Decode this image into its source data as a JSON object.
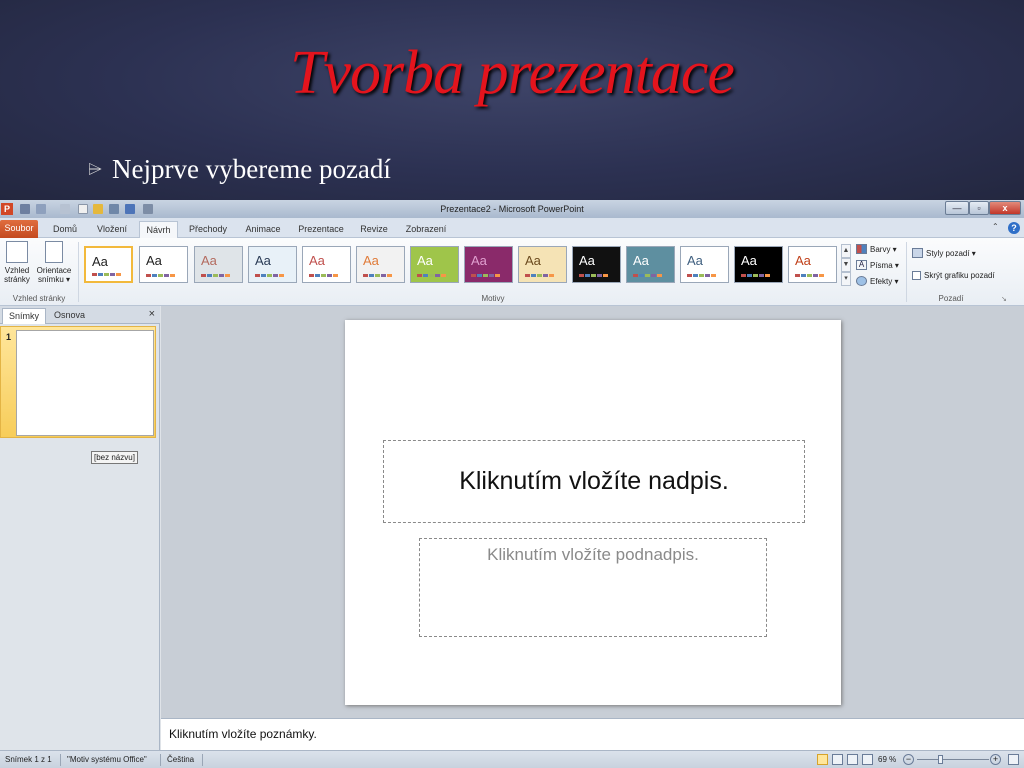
{
  "slide": {
    "title": "Tvorba prezentace",
    "bullet": "Nejprve vybereme pozadí"
  },
  "window": {
    "title": "Prezentace2 - Microsoft PowerPoint",
    "app_icon": "P",
    "minimize": "—",
    "restore": "▫",
    "close": "x"
  },
  "tabs": [
    "Soubor",
    "Domů",
    "Vložení",
    "Návrh",
    "Přechody",
    "Animace",
    "Prezentace",
    "Revize",
    "Zobrazení"
  ],
  "ribbon": {
    "page_setup": {
      "label_l1": "Vzhled",
      "label_l2": "stránky"
    },
    "orientation": {
      "label_l1": "Orientace",
      "label_l2": "snímku ▾"
    },
    "group_page": "Vzhled stránky",
    "group_themes": "Motivy",
    "theme_text": "Aa",
    "colors": "Barvy ▾",
    "fonts": "Písma ▾",
    "effects": "Efekty ▾",
    "bg_styles": "Styly pozadí ▾",
    "hide_bg": "Skrýt grafiku pozadí",
    "group_background": "Pozadí"
  },
  "themes": [
    {
      "bg": "#ffffff",
      "fg": "#222222"
    },
    {
      "bg": "#ffffff",
      "fg": "#222222"
    },
    {
      "bg": "#dfe4e8",
      "fg": "#b36a5e"
    },
    {
      "bg": "#e8f1f8",
      "fg": "#2a3b55"
    },
    {
      "bg": "#ffffff",
      "fg": "#c0504d"
    },
    {
      "bg": "#f2f2f2",
      "fg": "#e07b39"
    },
    {
      "bg": "#9fc54a",
      "fg": "#ffffff"
    },
    {
      "bg": "#8a2a6a",
      "fg": "#e0a0d0"
    },
    {
      "bg": "#f5e3b5",
      "fg": "#6b4a1e"
    },
    {
      "bg": "#111111",
      "fg": "#ffffff"
    },
    {
      "bg": "#5e8fa0",
      "fg": "#ffffff"
    },
    {
      "bg": "#ffffff",
      "fg": "#406080"
    },
    {
      "bg": "#000000",
      "fg": "#ffffff"
    },
    {
      "bg": "#ffffff",
      "fg": "#c0401a"
    }
  ],
  "left_pane": {
    "tab_slides": "Snímky",
    "tab_outline": "Osnova",
    "close": "×",
    "slide_number": "1",
    "tooltip": "[bez názvu]"
  },
  "editor": {
    "title_placeholder": "Kliknutím vložíte nadpis.",
    "subtitle_placeholder": "Kliknutím vložíte podnadpis.",
    "notes_placeholder": "Kliknutím vložíte poznámky."
  },
  "status": {
    "slide_count": "Snímek 1 z 1",
    "theme": "\"Motiv systému Office\"",
    "language": "Čeština",
    "zoom": "69 %",
    "zoom_out": "−",
    "zoom_in": "+"
  }
}
